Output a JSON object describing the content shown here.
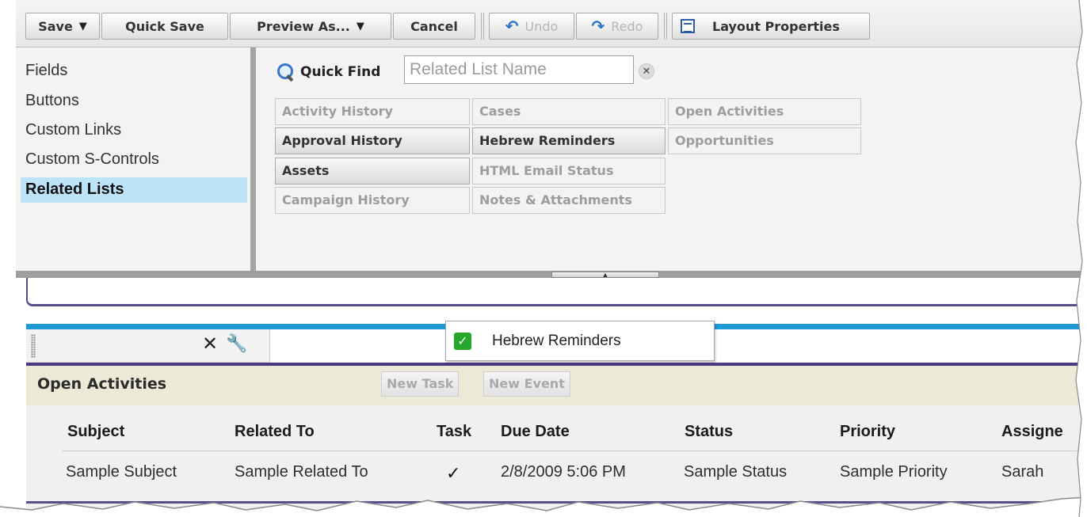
{
  "toolbar": {
    "save_label": "Save",
    "quick_save_label": "Quick Save",
    "preview_as_label": "Preview As...",
    "cancel_label": "Cancel",
    "undo_label": "Undo",
    "redo_label": "Redo",
    "layout_properties_label": "Layout Properties"
  },
  "palette": {
    "categories": [
      {
        "label": "Fields"
      },
      {
        "label": "Buttons"
      },
      {
        "label": "Custom Links"
      },
      {
        "label": "Custom S-Controls"
      },
      {
        "label": "Related Lists",
        "active": true
      }
    ],
    "quick_find_label": "Quick Find",
    "quick_find_placeholder": "Related List Name",
    "items": [
      {
        "label": "Activity History",
        "state": "available"
      },
      {
        "label": "Approval History",
        "state": "selected"
      },
      {
        "label": "Assets",
        "state": "selected"
      },
      {
        "label": "Campaign History",
        "state": "available"
      },
      {
        "label": "Cases",
        "state": "available"
      },
      {
        "label": "Hebrew Reminders",
        "state": "selected"
      },
      {
        "label": "HTML Email Status",
        "state": "available"
      },
      {
        "label": "Notes & Attachments",
        "state": "available"
      },
      {
        "label": "Open Activities",
        "state": "available"
      },
      {
        "label": "Opportunities",
        "state": "available"
      }
    ]
  },
  "drag_ghost": {
    "label": "Hebrew Reminders"
  },
  "section": {
    "title": "Open Activities",
    "new_task_label": "New Task",
    "new_event_label": "New Event",
    "columns": [
      "Subject",
      "Related To",
      "Task",
      "Due Date",
      "Status",
      "Priority",
      "Assigne"
    ],
    "row": {
      "subject": "Sample Subject",
      "related_to": "Sample Related To",
      "task": "✓",
      "due_date": "2/8/2009 5:06 PM",
      "status": "Sample Status",
      "priority": "Sample Priority",
      "assigned": "Sarah"
    }
  },
  "colors": {
    "accent_blue": "#1e9ad9",
    "section_purple": "#4a3a82",
    "active_category": "#bde3f9",
    "section_header_bg": "#ece9d6",
    "check_green": "#27a62c"
  },
  "icons": [
    "dropdown-caret-icon",
    "undo-icon",
    "redo-icon",
    "layout-properties-icon",
    "magnifier-icon",
    "clear-icon",
    "collapse-arrow-icon",
    "drag-grip-icon",
    "remove-icon",
    "wrench-icon",
    "check-icon"
  ]
}
